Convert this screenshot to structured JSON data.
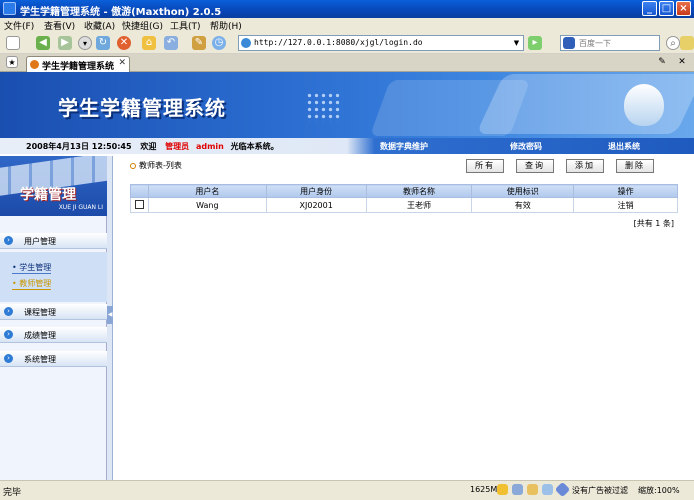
{
  "window": {
    "title": "学生学籍管理系统 - 傲游(Maxthon) 2.0.5"
  },
  "menu": [
    "文件(F)",
    "查看(V)",
    "收藏(A)",
    "快捷组(G)",
    "工具(T)",
    "帮助(H)"
  ],
  "address": {
    "url": "http://127.0.0.1:8080/xjgl/login.do"
  },
  "search": {
    "placeholder": "百度一下"
  },
  "tab": {
    "label": "学生学籍管理系统"
  },
  "banner": {
    "logo": "学生学籍管理系统"
  },
  "nav": {
    "datetime": "2008年4月13日 12:50:45",
    "welcome": "欢迎",
    "role": "管理员",
    "user": "admin",
    "suffix": "光临本系统。",
    "links": [
      "数据字典维护",
      "修改密码",
      "退出系统"
    ]
  },
  "sidebar": {
    "title": "学籍管理",
    "subtitle": "XUE JI GUAN LI",
    "items": [
      "用户管理",
      "课程管理",
      "成绩管理",
      "系统管理"
    ],
    "subitems": [
      "学生管理",
      "教师管理"
    ]
  },
  "main": {
    "breadcrumb": "教师表-列表",
    "buttons": [
      "所有",
      "查询",
      "添加",
      "删除"
    ],
    "columns": [
      "",
      "用户名",
      "用户身份",
      "教师名称",
      "使用标识",
      "操作"
    ],
    "rows": [
      {
        "username": "Wang",
        "identity": "XJ02001",
        "name": "王老师",
        "status": "有效",
        "action": "注销"
      }
    ],
    "total": "[共有 1 条]"
  },
  "status": {
    "text": "完毕",
    "memory": "1625M",
    "adblock": "没有广告被过滤",
    "zoom": "缩放:100%"
  }
}
